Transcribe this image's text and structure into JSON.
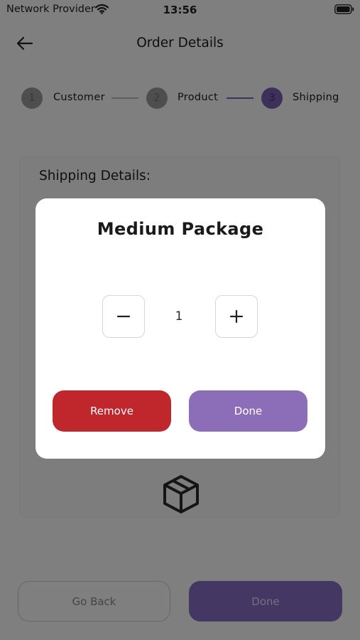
{
  "status_bar": {
    "carrier": "Network Provider",
    "time": "13:56"
  },
  "header": {
    "title": "Order Details",
    "back_icon": "arrow-left-icon"
  },
  "stepper": {
    "steps": [
      {
        "number": "1",
        "label": "Customer",
        "active": false
      },
      {
        "number": "2",
        "label": "Product",
        "active": false
      },
      {
        "number": "3",
        "label": "Shipping",
        "active": true
      }
    ]
  },
  "card": {
    "title": "Shipping Details:",
    "icon": "package-icon"
  },
  "footer": {
    "back_label": "Go Back",
    "done_label": "Done"
  },
  "modal": {
    "title": "Medium Package",
    "quantity": "1",
    "decrement_icon": "minus-icon",
    "increment_icon": "plus-icon",
    "remove_label": "Remove",
    "done_label": "Done"
  },
  "colors": {
    "accent": "#8b6ec8",
    "danger": "#c0272d",
    "overlay": "rgba(0,0,0,0.5)"
  }
}
